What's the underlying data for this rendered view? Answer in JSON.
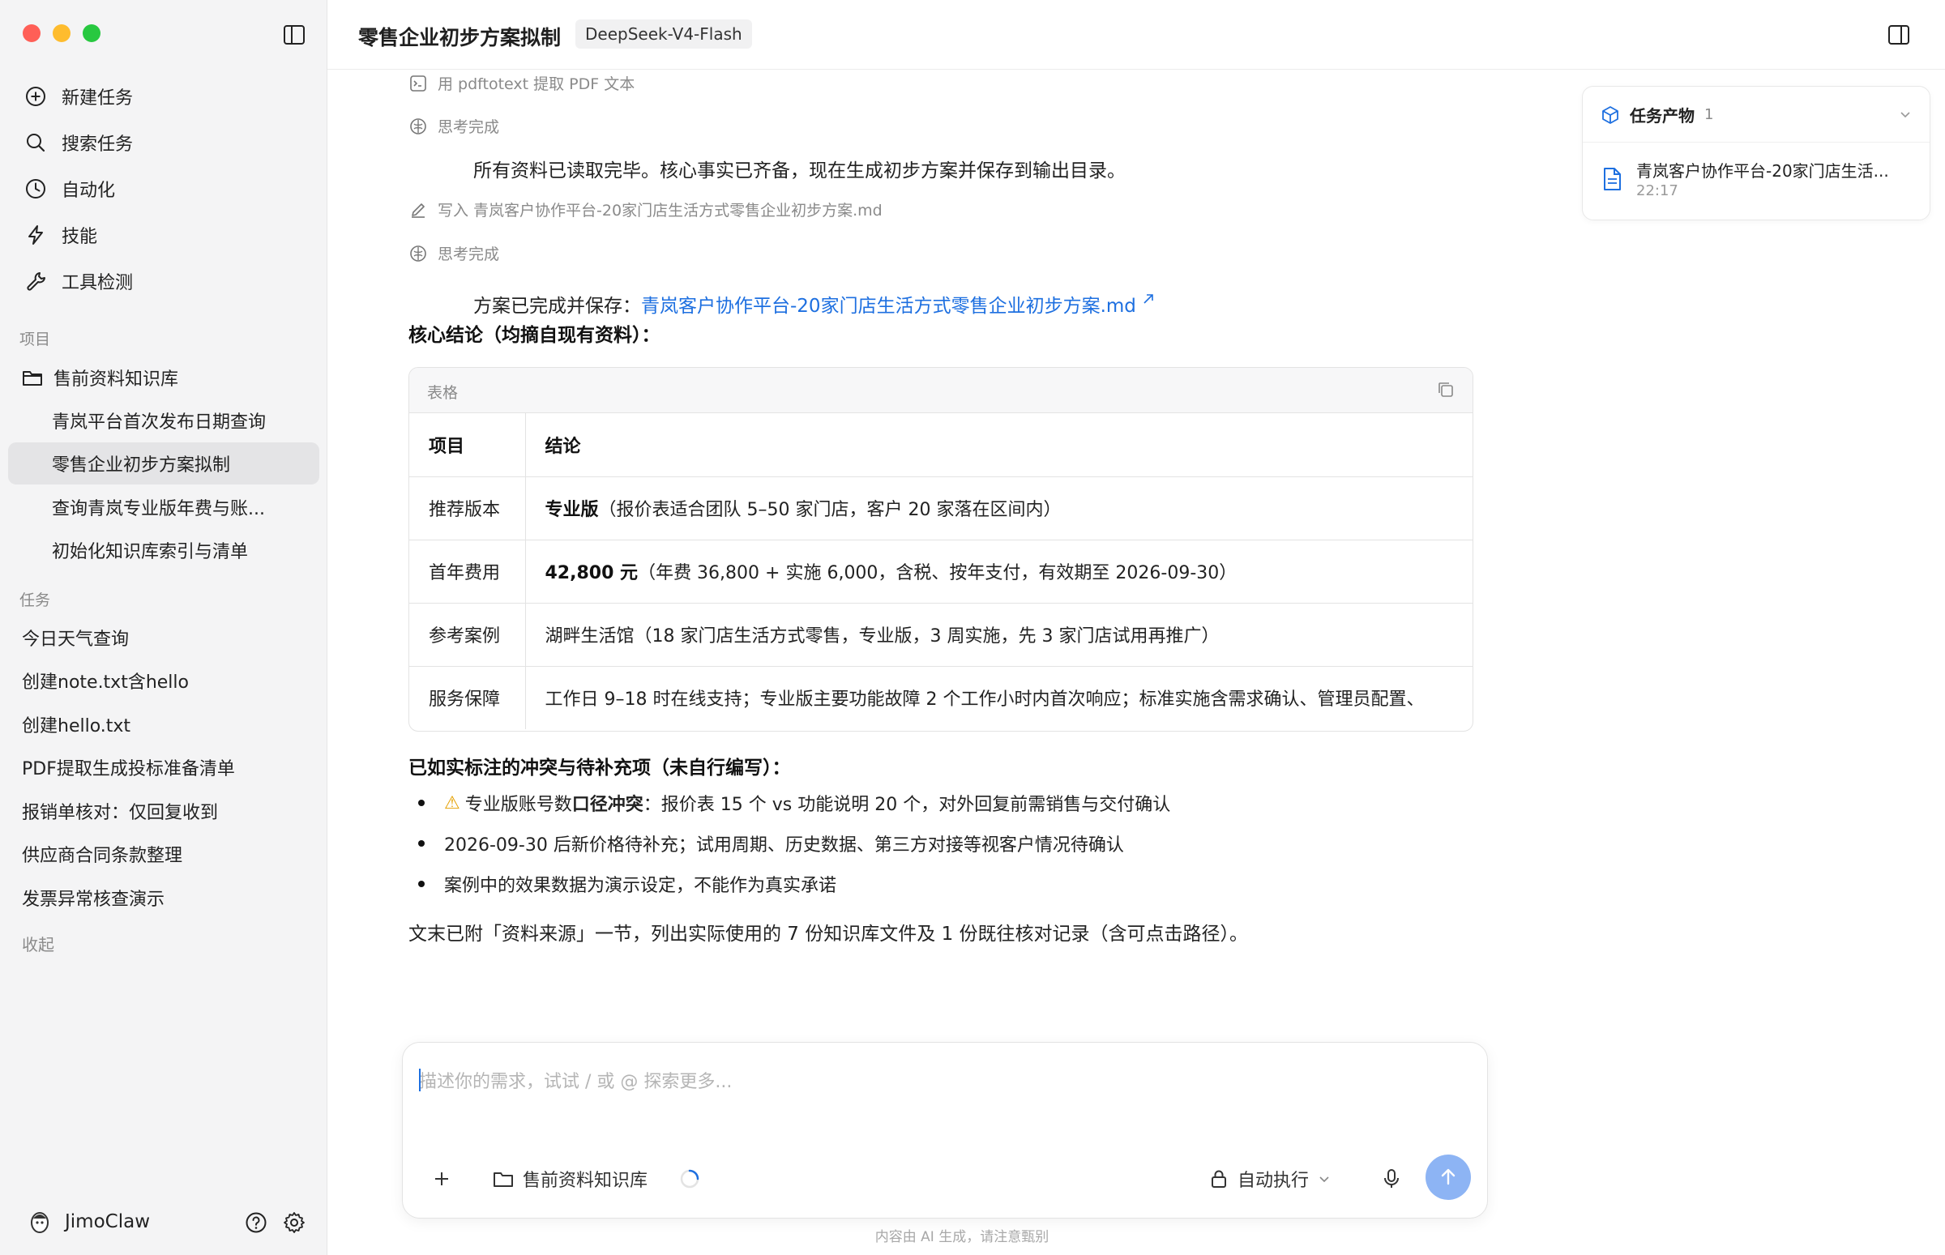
{
  "sidebar": {
    "nav": [
      {
        "label": "新建任务",
        "icon": "plus-circle-icon"
      },
      {
        "label": "搜索任务",
        "icon": "search-icon"
      },
      {
        "label": "自动化",
        "icon": "clock-icon"
      },
      {
        "label": "技能",
        "icon": "bolt-icon"
      },
      {
        "label": "工具检测",
        "icon": "wrench-icon"
      }
    ],
    "projects_label": "项目",
    "project_name": "售前资料知识库",
    "project_items": [
      "青岚平台首次发布日期查询",
      "零售企业初步方案拟制",
      "查询青岚专业版年费与账...",
      "初始化知识库索引与清单"
    ],
    "tasks_label": "任务",
    "tasks": [
      "今日天气查询",
      "创建note.txt含hello",
      "创建hello.txt",
      "PDF提取生成投标准备清单",
      "报销单核对：仅回复收到",
      "供应商合同条款整理",
      "发票异常核查演示"
    ],
    "collapse_label": "收起",
    "username": "JimoClaw"
  },
  "header": {
    "title": "零售企业初步方案拟制",
    "model": "DeepSeek-V4-Flash"
  },
  "conversation": {
    "step1": "用 pdftotext 提取 PDF 文本",
    "thinking1": "思考完成",
    "para1": "所有资料已读取完毕。核心事实已齐备，现在生成初步方案并保存到输出目录。",
    "step2": "写入 青岚客户协作平台-20家门店生活方式零售企业初步方案.md",
    "thinking2": "思考完成",
    "saved_prefix": "方案已完成并保存：",
    "saved_link": "青岚客户协作平台-20家门店生活方式零售企业初步方案.md",
    "conclusion_head": "核心结论（均摘自现有资料）：",
    "table_title": "表格",
    "table_headers": [
      "项目",
      "结论"
    ],
    "table_rows": [
      {
        "item": "推荐版本",
        "bold": "专业版",
        "rest": "（报价表适合团队 5–50 家门店，客户 20 家落在区间内）"
      },
      {
        "item": "首年费用",
        "bold": "42,800 元",
        "rest": "（年费 36,800 + 实施 6,000，含税、按年支付，有效期至 2026-09-30）"
      },
      {
        "item": "参考案例",
        "bold": "",
        "rest": "湖畔生活馆（18 家门店生活方式零售，专业版，3 周实施，先 3 家门店试用再推广）"
      },
      {
        "item": "服务保障",
        "bold": "",
        "rest": "工作日 9–18 时在线支持；专业版主要功能故障 2 个工作小时内首次响应；标准实施含需求确认、管理员配置、"
      }
    ],
    "conflict_head": "已如实标注的冲突与待补充项（未自行编写）：",
    "bullets": [
      {
        "pre": "专业版账号数",
        "bold": "口径冲突",
        "post": "：报价表 15 个 vs 功能说明 20 个，对外回复前需销售与交付确认"
      },
      {
        "pre": "2026-09-30 后新价格待补充；试用周期、历史数据、第三方对接等视客户情况待确认",
        "bold": "",
        "post": ""
      },
      {
        "pre": "案例中的效果数据为演示设定，不能作为真实承诺",
        "bold": "",
        "post": ""
      }
    ],
    "footer_para": "文末已附「资料来源」一节，列出实际使用的 7 份知识库文件及 1 份既往核对记录（含可点击路径）。"
  },
  "artifacts": {
    "title": "任务产物",
    "count": "1",
    "file_name": "青岚客户协作平台-20家门店生活...",
    "file_time": "22:17"
  },
  "composer": {
    "placeholder": "描述你的需求，试试 / 或 @ 探索更多...",
    "folder_label": "售前资料知识库",
    "exec_label": "自动执行"
  },
  "disclaimer": "内容由 AI 生成，请注意甄别",
  "colors": {
    "accent": "#1d6fe0",
    "send_button": "#8db4f4",
    "sidebar_bg": "#f4f4f5",
    "active_item": "#e4e4e6"
  }
}
